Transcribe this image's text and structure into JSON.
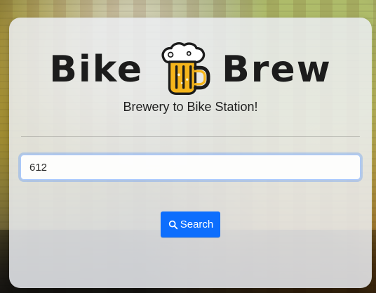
{
  "logo": {
    "left_word": "Bike",
    "right_word": "Brew",
    "mug_icon": "beer-mug-icon"
  },
  "subtitle": "Brewery to Bike Station!",
  "search": {
    "value": "612",
    "button_label": "Search",
    "button_icon": "search-icon"
  },
  "colors": {
    "accent": "#0d6efd",
    "card_bg": "#ebeef2"
  }
}
